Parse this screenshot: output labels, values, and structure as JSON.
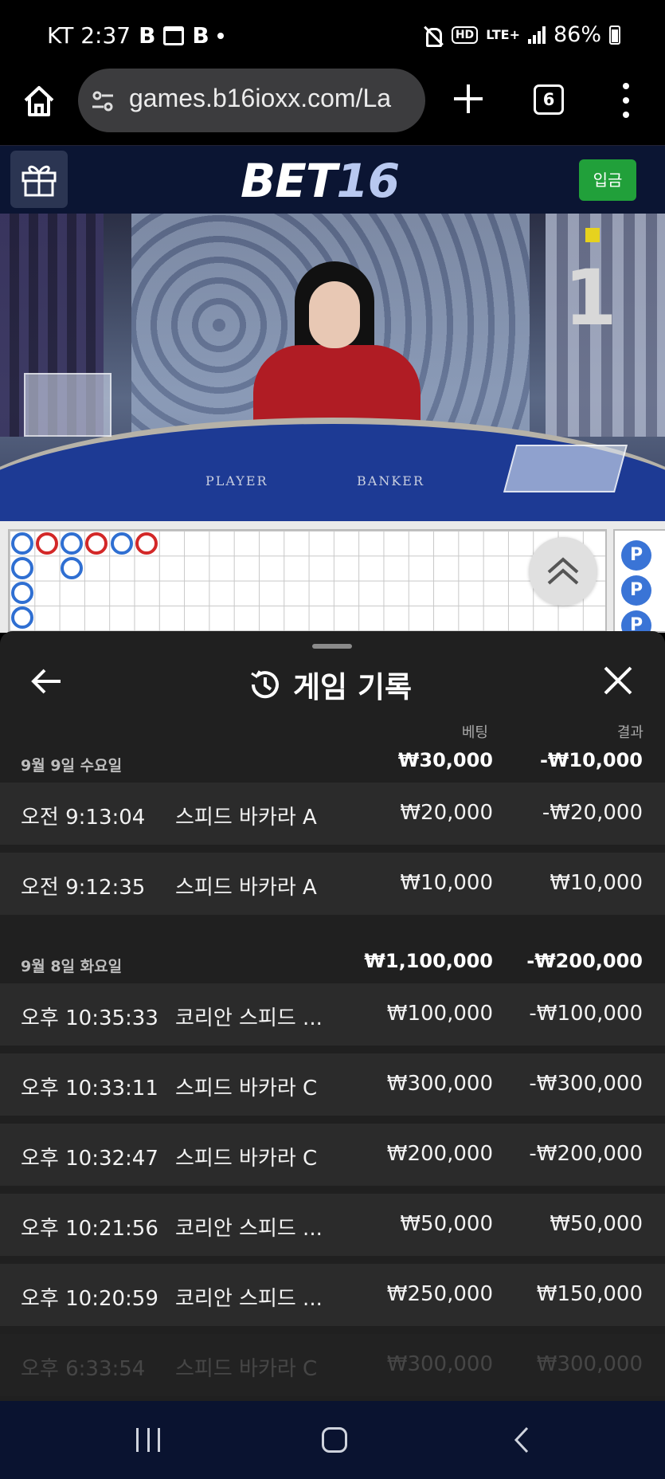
{
  "status_bar": {
    "carrier_time": "KT 2:37",
    "battery": "86%",
    "hd": "HD",
    "lte": "LTE+"
  },
  "browser": {
    "url": "games.b16ioxx.com/La",
    "tab_count": "6"
  },
  "site": {
    "logo_bet": "BET",
    "logo_num": "16",
    "deposit_label": "입금"
  },
  "video": {
    "round_number": "1",
    "label_player": "PLAYER",
    "label_banker": "BANKER"
  },
  "roadmap": {
    "beads": [
      {
        "col": 0,
        "row": 0,
        "color": "blue"
      },
      {
        "col": 1,
        "row": 0,
        "color": "red"
      },
      {
        "col": 2,
        "row": 0,
        "color": "blue"
      },
      {
        "col": 3,
        "row": 0,
        "color": "red"
      },
      {
        "col": 4,
        "row": 0,
        "color": "blue"
      },
      {
        "col": 5,
        "row": 0,
        "color": "red"
      },
      {
        "col": 0,
        "row": 1,
        "color": "blue"
      },
      {
        "col": 2,
        "row": 1,
        "color": "blue"
      },
      {
        "col": 0,
        "row": 2,
        "color": "blue"
      },
      {
        "col": 0,
        "row": 3,
        "color": "blue"
      }
    ],
    "side_label": "P"
  },
  "sheet": {
    "title": "게임 기록",
    "col_bet": "베팅",
    "col_result": "결과",
    "groups": [
      {
        "date": "9월 9일 수요일",
        "total_bet": "₩30,000",
        "total_result": "-₩10,000",
        "rows": [
          {
            "time": "오전 9:13:04",
            "game": "스피드 바카라 A",
            "bet": "₩20,000",
            "result": "-₩20,000"
          },
          {
            "time": "오전 9:12:35",
            "game": "스피드 바카라 A",
            "bet": "₩10,000",
            "result": "₩10,000"
          }
        ]
      },
      {
        "date": "9월 8일 화요일",
        "total_bet": "₩1,100,000",
        "total_result": "-₩200,000",
        "rows": [
          {
            "time": "오후 10:35:33",
            "game": "코리안 스피드 ...",
            "bet": "₩100,000",
            "result": "-₩100,000"
          },
          {
            "time": "오후 10:33:11",
            "game": "스피드 바카라 C",
            "bet": "₩300,000",
            "result": "-₩300,000"
          },
          {
            "time": "오후 10:32:47",
            "game": "스피드 바카라 C",
            "bet": "₩200,000",
            "result": "-₩200,000"
          },
          {
            "time": "오후 10:21:56",
            "game": "코리안 스피드 ...",
            "bet": "₩50,000",
            "result": "₩50,000"
          },
          {
            "time": "오후 10:20:59",
            "game": "코리안 스피드 ...",
            "bet": "₩250,000",
            "result": "₩150,000"
          },
          {
            "time": "오후 6:33:54",
            "game": "스피드 바카라 C",
            "bet": "₩300,000",
            "result": "₩300,000"
          }
        ]
      }
    ]
  },
  "colors": {
    "header_bg": "#0b1533",
    "deposit_green": "#21a03a",
    "bead_blue": "#2f6fd2",
    "bead_red": "#d32828",
    "sheet_bg": "#202020",
    "row_bg": "#2b2b2b"
  }
}
